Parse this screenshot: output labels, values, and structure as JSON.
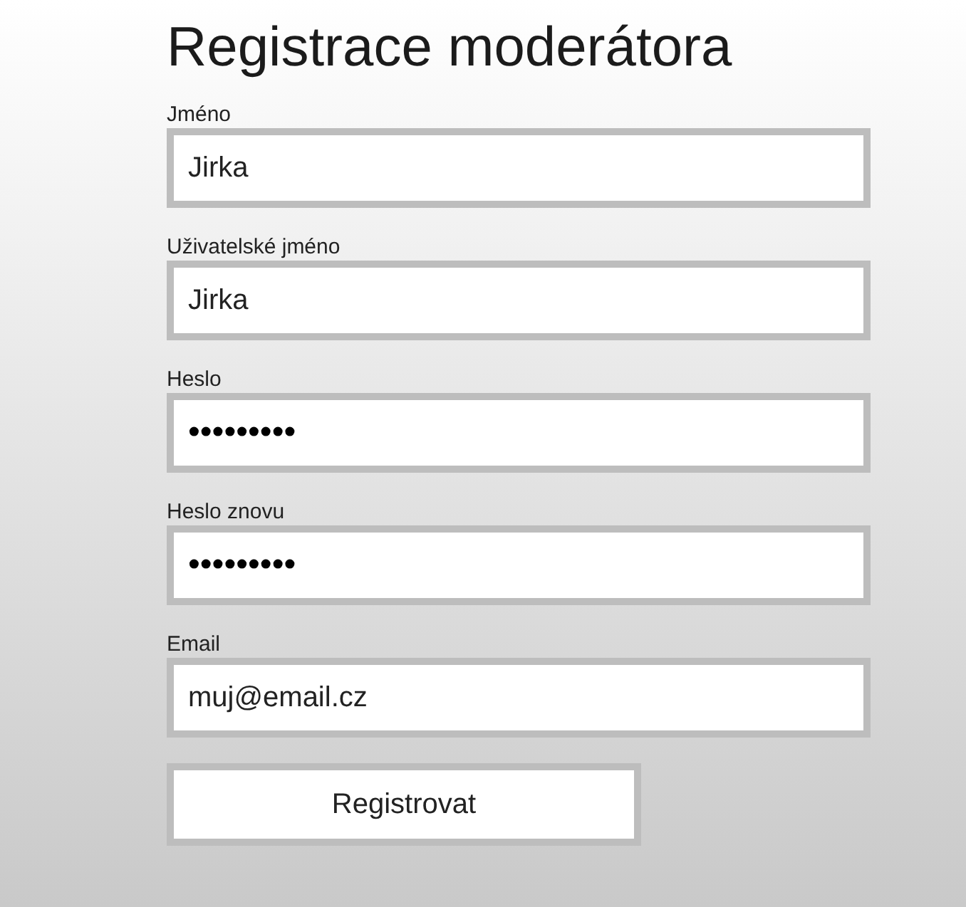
{
  "title": "Registrace moderátora",
  "fields": [
    {
      "label": "Jméno",
      "kind": "text",
      "value": "Jirka"
    },
    {
      "label": "Uživatelské jméno",
      "kind": "text",
      "value": "Jirka"
    },
    {
      "label": "Heslo",
      "kind": "password",
      "value": "•••••••••"
    },
    {
      "label": "Heslo znovu",
      "kind": "password",
      "value": "•••••••••"
    },
    {
      "label": "Email",
      "kind": "text",
      "value": "muj@email.cz"
    }
  ],
  "submit_button": "Registrovat"
}
